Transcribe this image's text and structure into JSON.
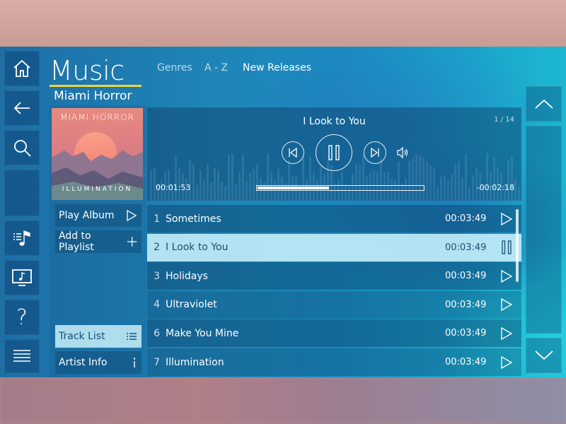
{
  "app": {
    "title": "Music",
    "nav": {
      "tabs": [
        {
          "label": "Genres"
        },
        {
          "label": "A - Z"
        },
        {
          "label": "New Releases"
        }
      ]
    }
  },
  "sidebar": {
    "items": [
      {
        "icon": "home-icon"
      },
      {
        "icon": "back-arrow-icon"
      },
      {
        "icon": "search-icon"
      },
      {
        "icon": "playlist-icon"
      },
      {
        "icon": "music-screen-icon"
      },
      {
        "icon": "help-icon",
        "glyph": "?"
      },
      {
        "icon": "menu-lines-icon"
      }
    ]
  },
  "artist": {
    "name": "Miami Horror",
    "album_art": {
      "band_text": "MIAMI HORROR",
      "album_text": "ILLUMINATION"
    }
  },
  "actions": {
    "play_album": "Play Album",
    "add_to_playlist": "Add to Playlist",
    "track_list": "Track List",
    "artist_info": "Artist Info"
  },
  "player": {
    "now_playing": "I Look to You",
    "track_position": "1 / 14",
    "elapsed": "00:01:53",
    "remaining": "-00:02:18",
    "progress": 0.43,
    "state": "playing"
  },
  "tracks": [
    {
      "num": "1",
      "title": "Sometimes",
      "duration": "00:03:49",
      "active": false
    },
    {
      "num": "2",
      "title": "I Look to You",
      "duration": "00:03:49",
      "active": true
    },
    {
      "num": "3",
      "title": "Holidays",
      "duration": "00:03:49",
      "active": false
    },
    {
      "num": "4",
      "title": "Ultraviolet",
      "duration": "00:03:49",
      "active": false
    },
    {
      "num": "6",
      "title": "Make You Mine",
      "duration": "00:03:49",
      "active": false
    },
    {
      "num": "7",
      "title": "Illumination",
      "duration": "00:03:49",
      "active": false
    }
  ],
  "colors": {
    "accent_underline": "#f2d33b",
    "highlight_row": "#c8f0fa",
    "highlight_text": "#1b4f75"
  }
}
